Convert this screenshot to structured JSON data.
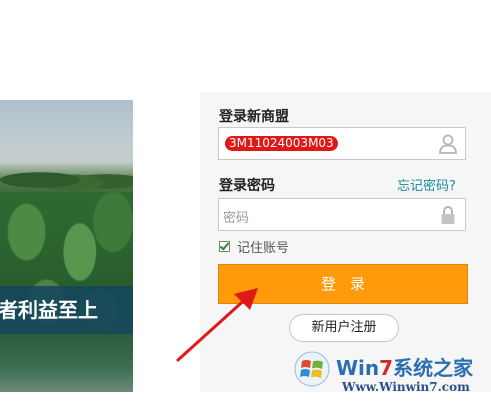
{
  "login_panel": {
    "account_label": "登录新商盟",
    "account_value": "3M11024003M03",
    "password_label": "登录密码",
    "forgot_link": "忘记密码?",
    "password_placeholder": "密码",
    "remember_label": "记住账号",
    "remember_checked": true,
    "login_button": "登录",
    "register_button": "新用户注册"
  },
  "promo": {
    "banner_text": "者利益至上"
  },
  "watermark": {
    "brand_prefix": "Win",
    "brand_seven": "7",
    "brand_suffix": "系统之家",
    "url": "Www.Winwin7.com"
  },
  "colors": {
    "accent_orange": "#ff9a0a",
    "link_teal": "#1a8a9a",
    "arrow_red": "#e01818"
  }
}
